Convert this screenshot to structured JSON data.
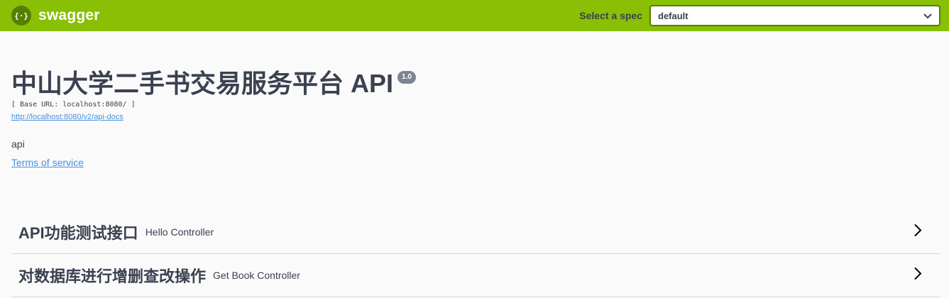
{
  "topbar": {
    "brand": "swagger",
    "spec_label": "Select a spec",
    "spec_value": "default"
  },
  "info": {
    "title": "中山大学二手书交易服务平台 API",
    "version": "1.0",
    "base_url": "[ Base URL: localhost:8080/ ]",
    "api_docs_url": "http://localhost:8080/v2/api-docs",
    "description": "api",
    "terms_label": "Terms of service"
  },
  "tags": [
    {
      "name": "API功能测试接口",
      "description": "Hello Controller"
    },
    {
      "name": "对数据库进行增删查改操作",
      "description": "Get Book Controller"
    }
  ],
  "colors": {
    "topbar_bg": "#89bf04",
    "select_border": "#547f00",
    "link": "#4990e2",
    "text": "#3b4151"
  }
}
